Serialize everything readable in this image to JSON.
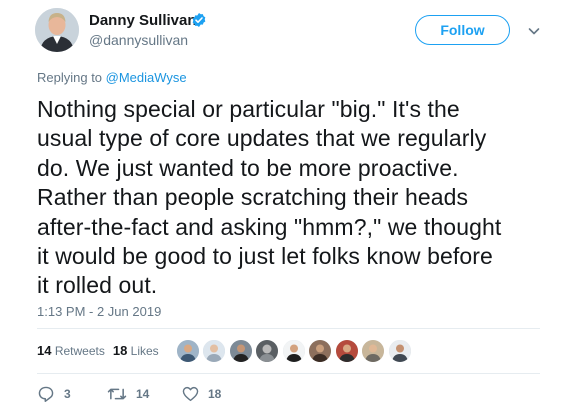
{
  "author": {
    "display_name": "Danny Sullivan",
    "handle": "@dannysullivan",
    "avatar_icon": "avatar",
    "verified_icon": "verified-badge-icon",
    "verified_color": "#1da1f2"
  },
  "header": {
    "follow_label": "Follow",
    "caret_icon": "chevron-down-icon"
  },
  "replying": {
    "prefix": "Replying to ",
    "mention": "@MediaWyse"
  },
  "tweet": {
    "lines": [
      "Nothing special or particular \"big.\" It's the",
      "usual type of core updates that we regularly",
      "do. We just wanted to be more proactive.",
      "Rather than people scratching their heads",
      "after-the-fact and asking \"hmm?,\" we thought",
      "it would be good to just let folks know before",
      "it rolled out."
    ],
    "timestamp": "1:13 PM - 2 Jun 2019"
  },
  "stats": {
    "retweets_count": "14",
    "retweets_label": "Retweets",
    "likes_count": "18",
    "likes_label": "Likes",
    "liker_count": 9
  },
  "actions": {
    "reply": {
      "icon": "reply-icon",
      "count": "3"
    },
    "retweet": {
      "icon": "retweet-icon",
      "count": "14"
    },
    "like": {
      "icon": "heart-icon",
      "count": "18"
    }
  },
  "colors": {
    "accent": "#1da1f2",
    "link": "#1b95e0",
    "text": "#14171a",
    "muted": "#657786",
    "divider": "#e6ecf0"
  }
}
